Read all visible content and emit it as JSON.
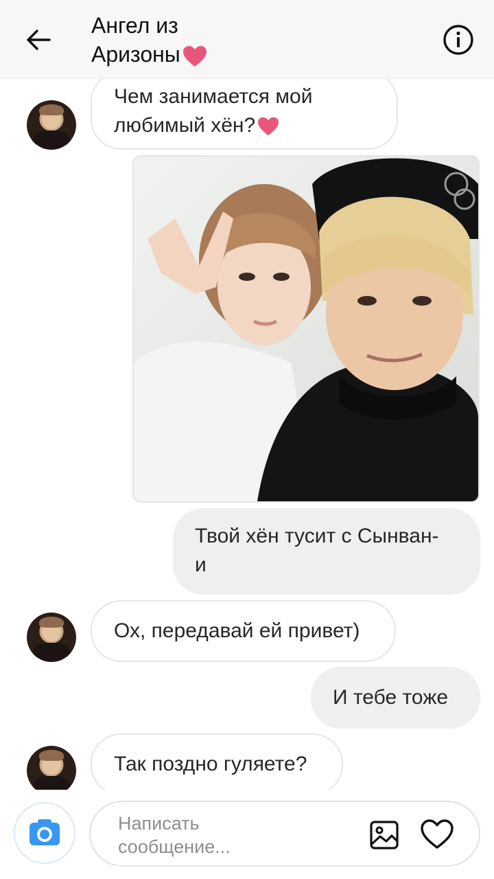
{
  "header": {
    "title_line1": "Ангел из",
    "title_line2": "Аризоны"
  },
  "messages": [
    {
      "direction": "incoming",
      "line1": "Чем занимается мой",
      "line2": "любимый хён?",
      "has_heart": true
    },
    {
      "direction": "outgoing",
      "type": "photo"
    },
    {
      "direction": "outgoing",
      "line1": "Твой хён тусит с Сынван-",
      "line2": "и"
    },
    {
      "direction": "incoming",
      "text": "Ох, передавай ей привет)"
    },
    {
      "direction": "outgoing",
      "text": "И тебе тоже"
    },
    {
      "direction": "incoming",
      "text": "Так поздно гуляете?"
    }
  ],
  "composer": {
    "placeholder_line1": "Написать",
    "placeholder_line2": "сообщение..."
  },
  "colors": {
    "accent_blue": "#3897f0",
    "heart_pink": "#e8577a",
    "outgoing_bubble": "#efefef"
  },
  "icons": [
    "back-arrow-icon",
    "info-icon",
    "camera-icon",
    "gallery-icon",
    "heart-icon"
  ]
}
